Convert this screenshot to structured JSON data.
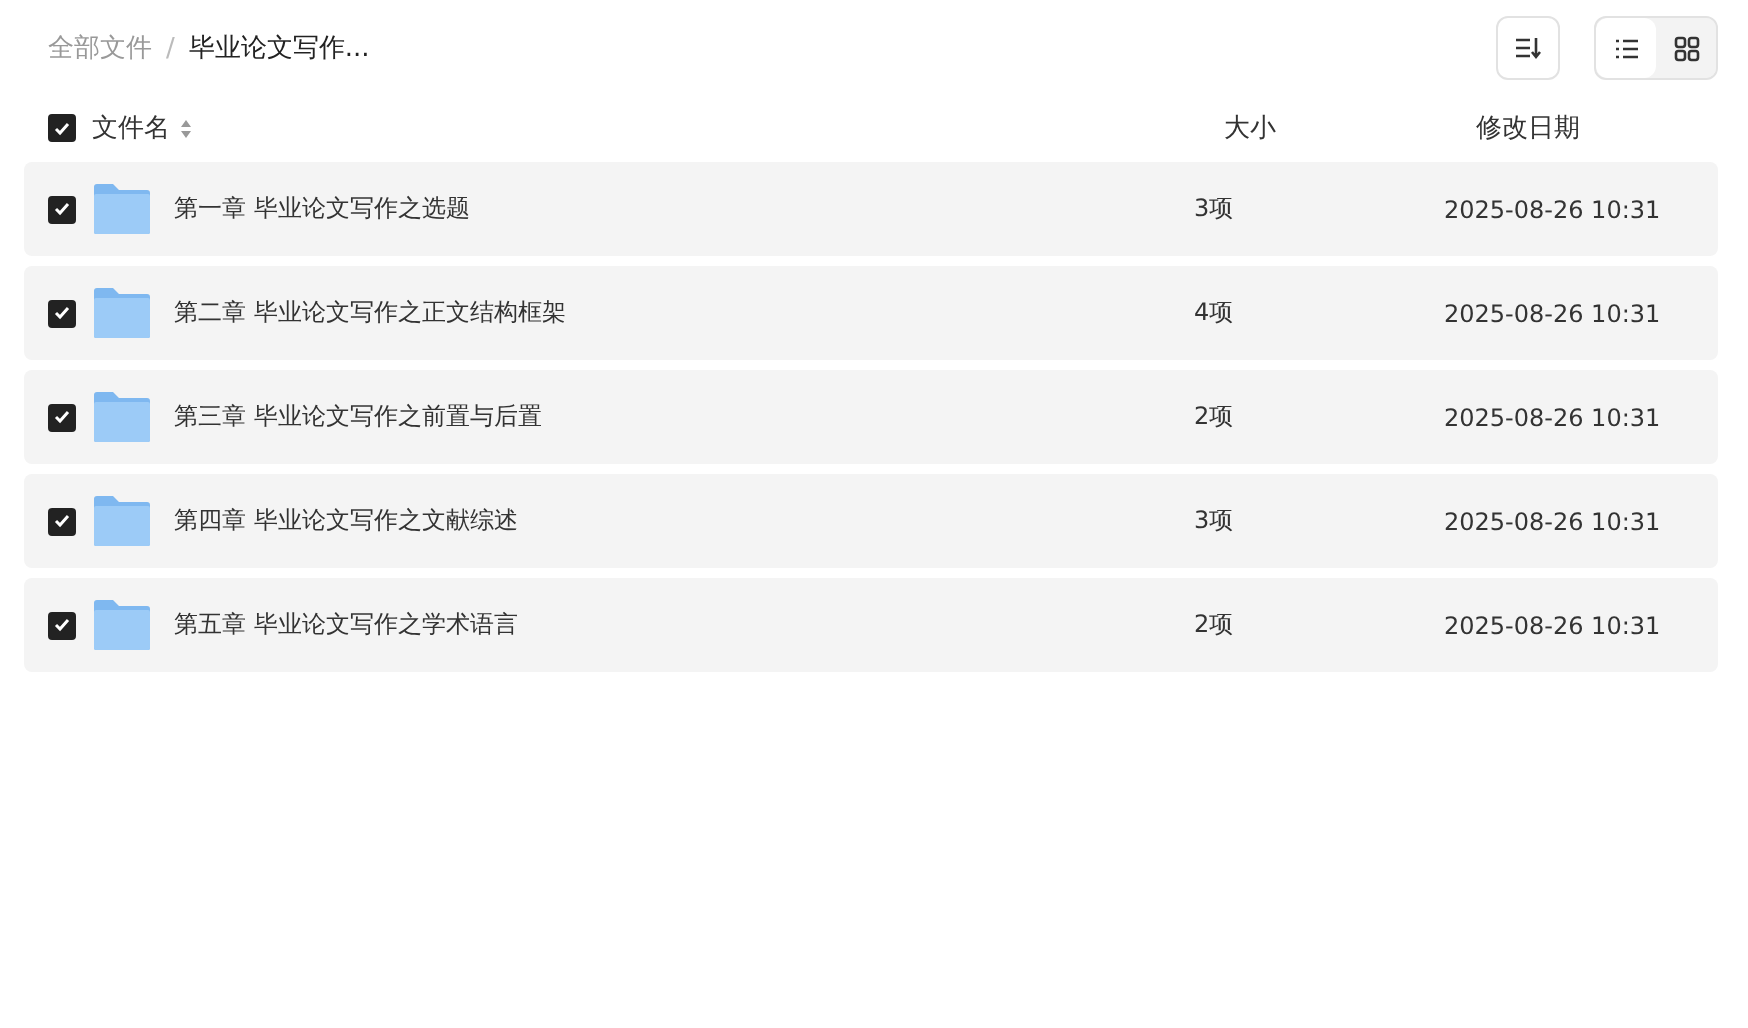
{
  "breadcrumb": [
    {
      "label": "全部文件",
      "current": false
    },
    {
      "label": "毕业论文写作...",
      "current": true
    }
  ],
  "breadcrumb_separator": "/",
  "view_modes": [
    {
      "kind": "list",
      "selected": true
    },
    {
      "kind": "grid",
      "selected": false
    }
  ],
  "table": {
    "select_all_checked": true,
    "columns": [
      "文件名",
      "大小",
      "修改日期"
    ],
    "rows": [
      {
        "name": "第一章 毕业论文写作之选题",
        "size": "3项",
        "modified": "2025-08-26 10:31",
        "checked": true
      },
      {
        "name": "第二章 毕业论文写作之正文结构框架",
        "size": "4项",
        "modified": "2025-08-26 10:31",
        "checked": true
      },
      {
        "name": "第三章 毕业论文写作之前置与后置",
        "size": "2项",
        "modified": "2025-08-26 10:31",
        "checked": true
      },
      {
        "name": "第四章 毕业论文写作之文献综述",
        "size": "3项",
        "modified": "2025-08-26 10:31",
        "checked": true
      },
      {
        "name": "第五章 毕业论文写作之学术语言",
        "size": "2项",
        "modified": "2025-08-26 10:31",
        "checked": true
      }
    ]
  }
}
